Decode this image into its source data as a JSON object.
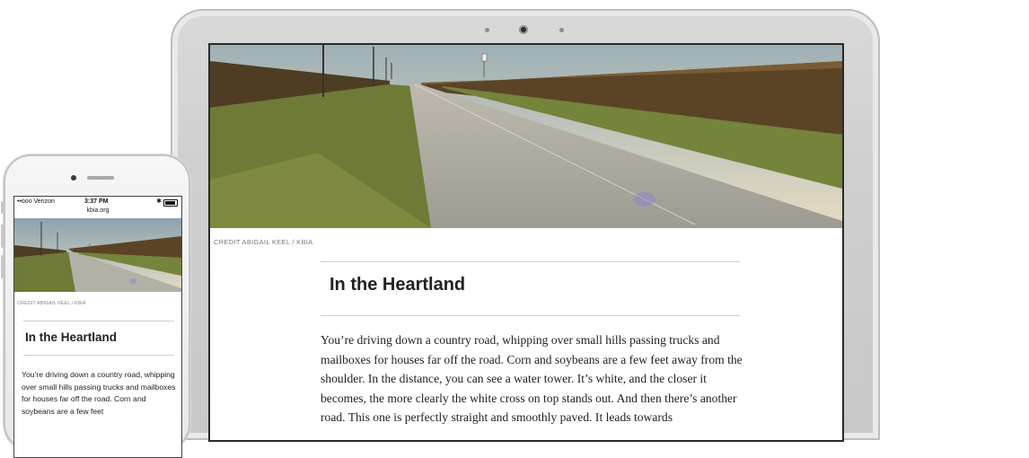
{
  "article": {
    "photo_credit": "CREDIT ABIGAIL KEEL / KBIA",
    "title": "In the Heartland",
    "body": "You’re driving down a country road, whipping over small hills passing trucks and mailboxes for houses far off the road. Corn and soybeans are a few feet away from the shoulder. In the distance, you can see a water tower. It’s white, and the closer it becomes, the more clearly the white cross on top stands out. And then there’s another road. This one is perfectly straight and smoothly paved. It leads towards",
    "body_mobile": "You’re driving down a country road, whipping over small hills passing trucks and mailboxes for houses far off the road. Corn and soybeans are a few feet"
  },
  "phone_status": {
    "carrier": "••ooo Verizon",
    "time": "3:37 PM",
    "url": "kbia.org"
  },
  "colors": {
    "sky": "#d8d3bd",
    "road": "#b9b6ad",
    "grass": "#6f7a3b",
    "corn": "#5a4428"
  }
}
